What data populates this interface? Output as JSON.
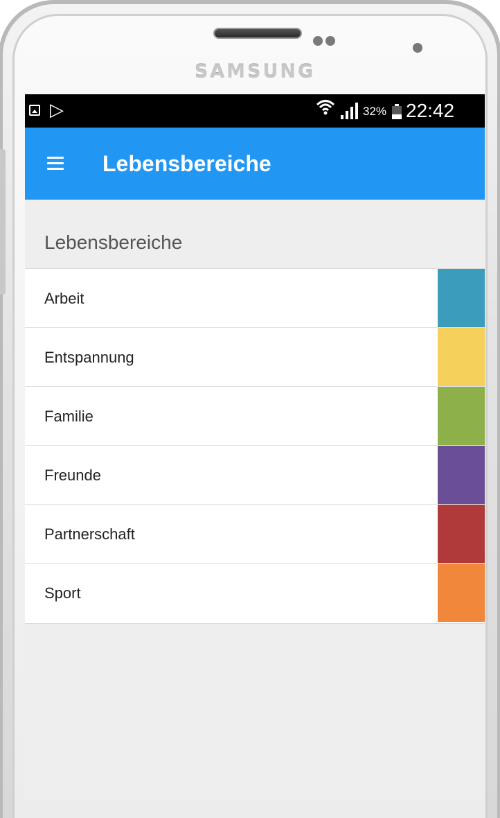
{
  "device": {
    "brand": "SAMSUNG"
  },
  "status_bar": {
    "battery_percent": "32%",
    "time": "22:42",
    "icons": [
      "gallery-icon",
      "play-store-icon",
      "wifi-icon",
      "signal-icon",
      "battery-icon"
    ]
  },
  "app_bar": {
    "menu_icon": "hamburger-menu-icon",
    "title": "Lebensbereiche",
    "background_color": "#2196f3"
  },
  "section": {
    "header": "Lebensbereiche"
  },
  "list": {
    "items": [
      {
        "label": "Arbeit",
        "color": "#3b9cbc"
      },
      {
        "label": "Entspannung",
        "color": "#f5d05a"
      },
      {
        "label": "Familie",
        "color": "#8db04a"
      },
      {
        "label": "Freunde",
        "color": "#6b4f96"
      },
      {
        "label": "Partnerschaft",
        "color": "#b03a3a"
      },
      {
        "label": "Sport",
        "color": "#f0873a"
      }
    ]
  }
}
